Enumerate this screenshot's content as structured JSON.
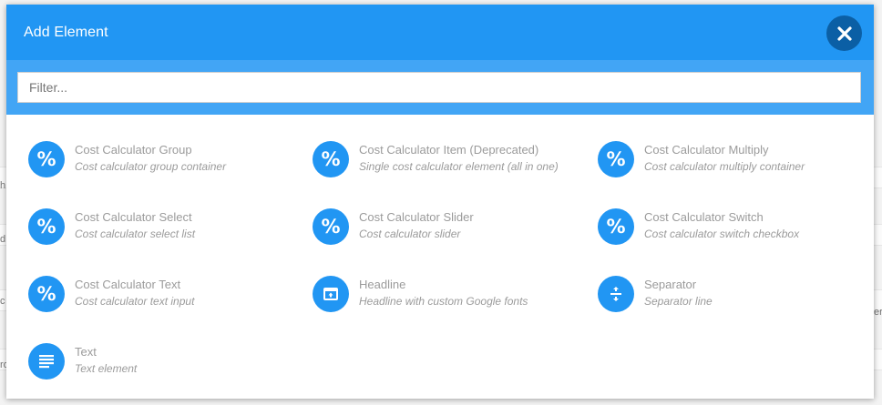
{
  "modal": {
    "title": "Add Element",
    "filter_placeholder": "Filter..."
  },
  "background_fragments": [
    "h",
    "d",
    "c",
    "ro",
    "er"
  ],
  "elements": [
    {
      "name": "Cost Calculator Group",
      "description": "Cost calculator group container",
      "icon": "percent-icon"
    },
    {
      "name": "Cost Calculator Item (Deprecated)",
      "description": "Single cost calculator element (all in one)",
      "icon": "percent-icon"
    },
    {
      "name": "Cost Calculator Multiply",
      "description": "Cost calculator multiply container",
      "icon": "percent-icon"
    },
    {
      "name": "Cost Calculator Select",
      "description": "Cost calculator select list",
      "icon": "percent-icon"
    },
    {
      "name": "Cost Calculator Slider",
      "description": "Cost calculator slider",
      "icon": "percent-icon"
    },
    {
      "name": "Cost Calculator Switch",
      "description": "Cost calculator switch checkbox",
      "icon": "percent-icon"
    },
    {
      "name": "Cost Calculator Text",
      "description": "Cost calculator text input",
      "icon": "percent-icon"
    },
    {
      "name": "Headline",
      "description": "Headline with custom Google fonts",
      "icon": "headline-icon"
    },
    {
      "name": "Separator",
      "description": "Separator line",
      "icon": "separator-icon"
    },
    {
      "name": "Text",
      "description": "Text element",
      "icon": "text-lines-icon"
    }
  ],
  "colors": {
    "header": "#2196f3",
    "filter_bar": "#42a5f5",
    "close_button": "#0b5fa5",
    "icon_circle": "#2196f3",
    "item_text": "#9b9b9b"
  }
}
